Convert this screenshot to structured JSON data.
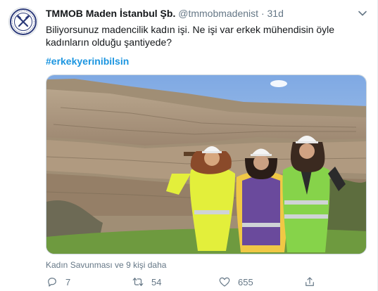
{
  "tweet": {
    "author_name": "TMMOB Maden İstanbul Şb.",
    "handle": "@tmmobmadenist",
    "separator": "·",
    "time": "31d",
    "text": "Biliyorsunuz madencilik kadın işi. Ne işi var erkek mühendisin öyle kadınların olduğu şantiyede?",
    "hashtag": "#erkekyerinibilsin",
    "social_context": "Kadın Savunması ve 9 kişi daha",
    "actions": {
      "reply_count": "7",
      "retweet_count": "54",
      "like_count": "655"
    }
  },
  "icons": {
    "avatar": "chamber-logo",
    "caret": "chevron-down-icon",
    "reply": "reply-icon",
    "retweet": "retweet-icon",
    "like": "heart-icon",
    "share": "share-icon"
  },
  "colors": {
    "link": "#1b95e0",
    "secondary_text": "#657786",
    "primary_text": "#14171a"
  }
}
